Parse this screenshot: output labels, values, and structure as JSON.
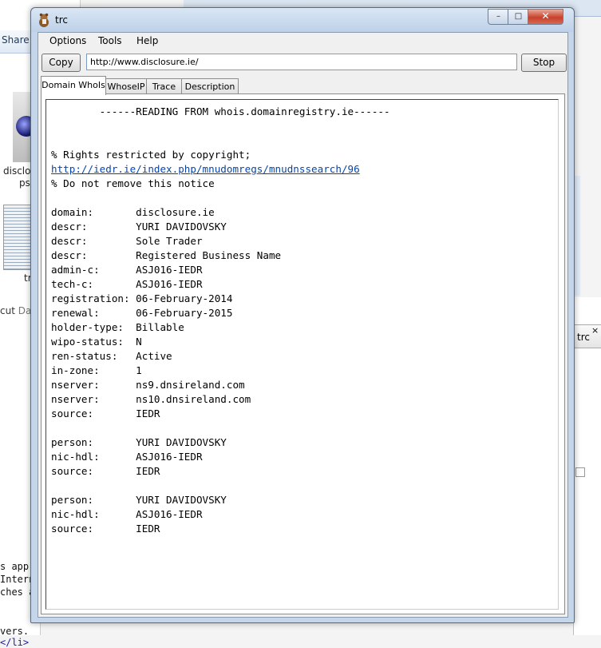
{
  "background": {
    "share_label": "Share",
    "file_label_1a": "disclos",
    "file_label_1b": "ps",
    "file_label_2": "tr",
    "status_cut": "cut",
    "status_date": "Dat",
    "code_lines": [
      "s app",
      "Intern",
      "ches a"
    ],
    "code_last_prefix": "vers.",
    "code_last_tag": "</li>",
    "other_tab_label": "trc",
    "other_tab_close": "×"
  },
  "window": {
    "title": "trc",
    "min_label": "–",
    "max_label": "□",
    "close_label": "✕"
  },
  "menu": {
    "options": "Options",
    "tools": "Tools",
    "help": "Help"
  },
  "toolbar": {
    "copy_label": "Copy",
    "url_value": "http://www.disclosure.ie/",
    "stop_label": "Stop"
  },
  "tabs": [
    {
      "label": "Domain WhoIs",
      "active": true
    },
    {
      "label": "WhoseIP",
      "active": false
    },
    {
      "label": "Trace",
      "active": false
    },
    {
      "label": "Description",
      "active": false
    }
  ],
  "output": {
    "header": "        ------READING FROM whois.domainregistry.ie------",
    "copyright": "% Rights restricted by copyright;",
    "link": "http://iedr.ie/index.php/mnudomregs/mnudnssearch/96",
    "notice": "% Do not remove this notice",
    "record_lines": [
      "domain:       disclosure.ie",
      "descr:        YURI DAVIDOVSKY",
      "descr:        Sole Trader",
      "descr:        Registered Business Name",
      "admin-c:      ASJ016-IEDR",
      "tech-c:       ASJ016-IEDR",
      "registration: 06-February-2014",
      "renewal:      06-February-2015",
      "holder-type:  Billable",
      "wipo-status:  N",
      "ren-status:   Active",
      "in-zone:      1",
      "nserver:      ns9.dnsireland.com",
      "nserver:      ns10.dnsireland.com",
      "source:       IEDR",
      "",
      "person:       YURI DAVIDOVSKY",
      "nic-hdl:      ASJ016-IEDR",
      "source:       IEDR",
      "",
      "person:       YURI DAVIDOVSKY",
      "nic-hdl:      ASJ016-IEDR",
      "source:       IEDR"
    ]
  }
}
